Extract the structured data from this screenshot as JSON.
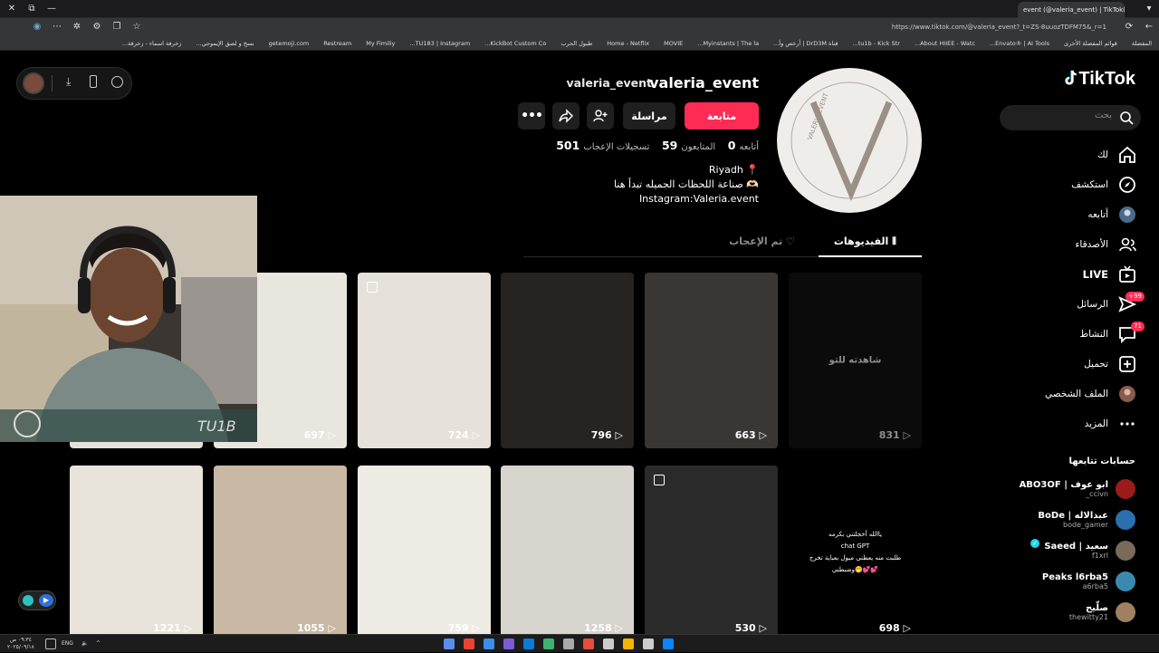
{
  "browser": {
    "active_tab": "event (@valeria_event) | TikTok(71)",
    "url": "https://www.tiktok.com/@valeria_event?_t=ZS-8uuozTDFM75&_r=1",
    "bookmarks": [
      "المفضلة",
      "قوائم المفضلة الأخرى",
      "Envato® | AI Tools...",
      "About HIIEE - Watc...",
      "tu1b - Kick Str...",
      "قناة DrD3M | أرخص وأ...",
      "Myinstants | The la...",
      "MOVIE",
      "Home - Netflix",
      "طبول الحرب",
      "KickBot Custom Co...",
      "TU183 | Instagram...",
      "My Fimiliy",
      "Restream",
      "getemoji.com",
      "نسخ و لصق الإيموجي...",
      "زخرفة اسماء - زخرفة..."
    ]
  },
  "floating_toolbar": {
    "icons": [
      "avatar",
      "download-icon",
      "phone-icon",
      "compass-icon"
    ]
  },
  "sidebar": {
    "logo": "TikTok",
    "search_placeholder": "بحث",
    "nav": [
      {
        "label": "لك",
        "icon": "home-icon"
      },
      {
        "label": "استكشف",
        "icon": "compass-icon"
      },
      {
        "label": "أتابعه",
        "icon": "avatar-icon"
      },
      {
        "label": "الأصدقاء",
        "icon": "friends-icon"
      },
      {
        "label": "LIVE",
        "icon": "live-icon"
      },
      {
        "label": "الرسائل",
        "icon": "messages-icon",
        "badge": "+99"
      },
      {
        "label": "النشاط",
        "icon": "activity-icon",
        "badge": "71"
      },
      {
        "label": "تحميل",
        "icon": "upload-icon"
      },
      {
        "label": "الملف الشخصي",
        "icon": "profile-avatar-icon"
      },
      {
        "label": "المزيد",
        "icon": "more-icon"
      }
    ],
    "following_title": "حسابات تتابعها",
    "accounts": [
      {
        "name": "ABO3OF | ابو عوف",
        "handle": "_ccivn",
        "color": "#9b1b1b"
      },
      {
        "name": "BoDe | عبدالاله",
        "handle": "bode_gamer",
        "color": "#2a6fb0"
      },
      {
        "name": "Saeed | سعيد",
        "handle": "f1xrl",
        "color": "#7a6a5a",
        "verified": true
      },
      {
        "name": "Peaks l6rba5",
        "handle": "a6rba5",
        "color": "#3a8ab0"
      },
      {
        "name": "صلّيح",
        "handle": "thewitty21",
        "color": "#a08060"
      }
    ]
  },
  "profile": {
    "username": "valeria_event",
    "nickname": "valeria_event",
    "follow_label": "متابعة",
    "message_label": "مراسلة",
    "following_label": "أتابعه",
    "following_count": "0",
    "followers_label": "المتابعون",
    "followers_count": "59",
    "likes_label": "تسجيلات الإعجاب",
    "likes_count": "501",
    "bio": [
      "Riyadh 📍",
      "صناعة اللحظات الجميله تبدأ هنا 🫶🏻",
      "Instagram:Valeria.event"
    ],
    "avatar_letter": "V",
    "avatar_ring_text": "VALERIA EVENT"
  },
  "tabs": {
    "videos": "الفيديوهات",
    "liked": "تم الإعجاب"
  },
  "videos_row1": [
    {
      "count": "697"
    },
    {
      "count": "724"
    },
    {
      "count": "796"
    },
    {
      "count": "663"
    },
    {
      "count": "831",
      "pinned_label": "شاهدته للتو"
    }
  ],
  "videos_row2": [
    {
      "count": "1221"
    },
    {
      "count": "1055"
    },
    {
      "count": "759"
    },
    {
      "count": "1258"
    },
    {
      "count": "530"
    },
    {
      "count": "698",
      "caption": [
        "ياالله  أخجلتني بكرمه",
        "chat GPT",
        "طلبت منه يعطني ميول بعباية تخرج",
        "وضبطني🤭💕💕"
      ]
    }
  ],
  "row1_partial_count": "",
  "taskbar": {
    "lang": "ENG",
    "time": "٠٩:٣٤ ص",
    "date": "٢٠٢٥/٠٩/١٨"
  }
}
